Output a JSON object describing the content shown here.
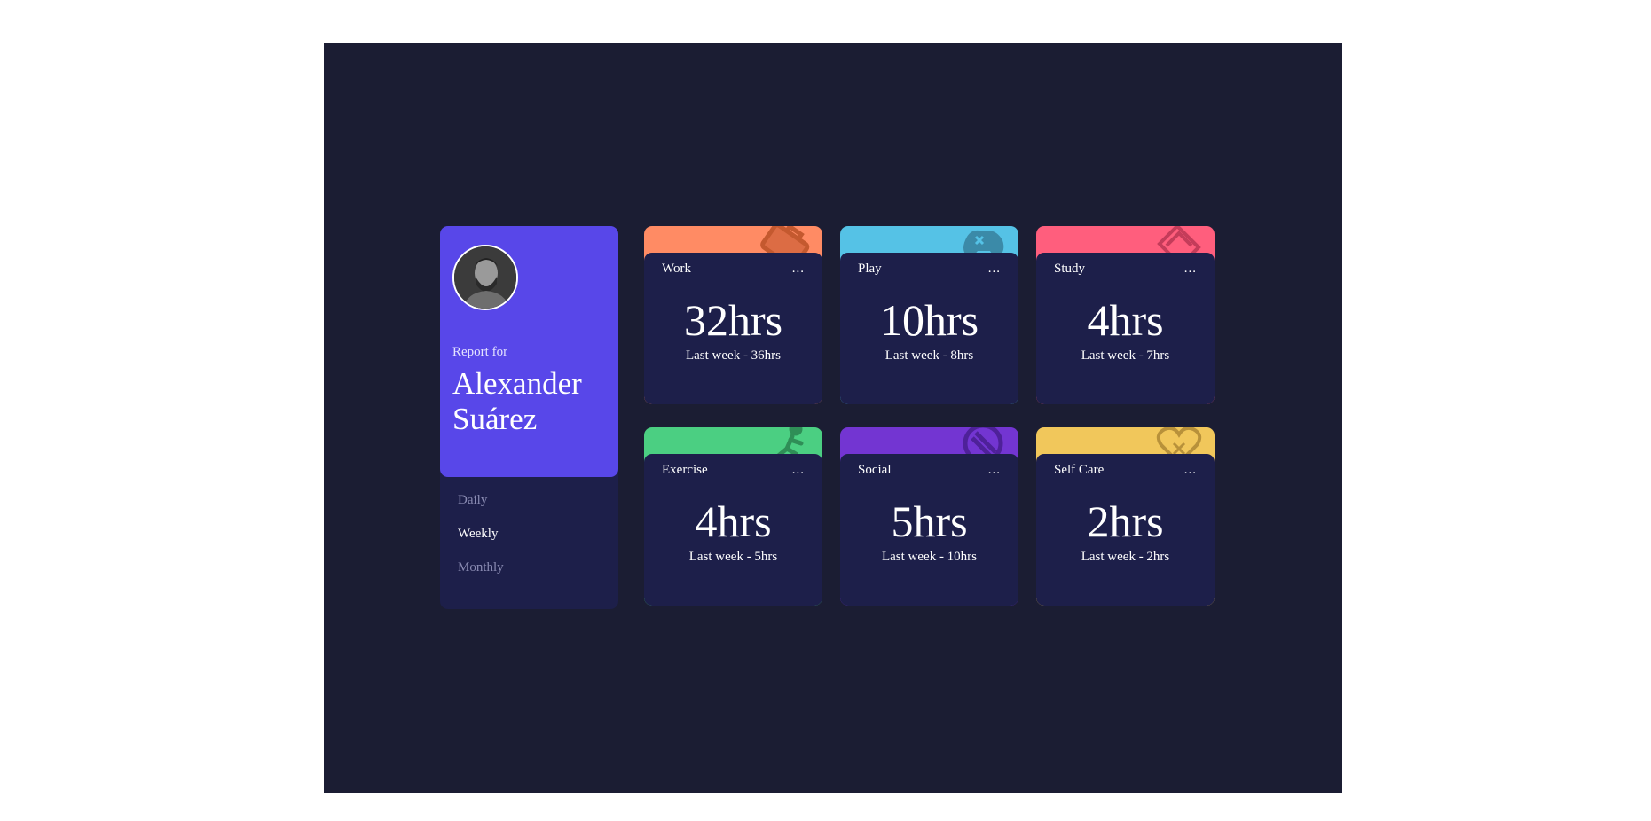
{
  "profile": {
    "report_for": "Report for",
    "name": "Alexander Suárez",
    "periods": [
      {
        "label": "Daily",
        "active": false
      },
      {
        "label": "Weekly",
        "active": true
      },
      {
        "label": "Monthly",
        "active": false
      }
    ]
  },
  "activities": [
    {
      "title": "Work",
      "current": "32hrs",
      "previous": "Last week - 36hrs",
      "color": "#ff8b64",
      "icon": "briefcase-icon"
    },
    {
      "title": "Play",
      "current": "10hrs",
      "previous": "Last week - 8hrs",
      "color": "#55c2e6",
      "icon": "gamepad-icon"
    },
    {
      "title": "Study",
      "current": "4hrs",
      "previous": "Last week - 7hrs",
      "color": "#ff5e7d",
      "icon": "book-icon"
    },
    {
      "title": "Exercise",
      "current": "4hrs",
      "previous": "Last week - 5hrs",
      "color": "#4bcf82",
      "icon": "running-icon"
    },
    {
      "title": "Social",
      "current": "5hrs",
      "previous": "Last week - 10hrs",
      "color": "#7335d2",
      "icon": "chat-icon"
    },
    {
      "title": "Self Care",
      "current": "2hrs",
      "previous": "Last week - 2hrs",
      "color": "#f1c75b",
      "icon": "heart-icon"
    }
  ],
  "card_menu": "..."
}
